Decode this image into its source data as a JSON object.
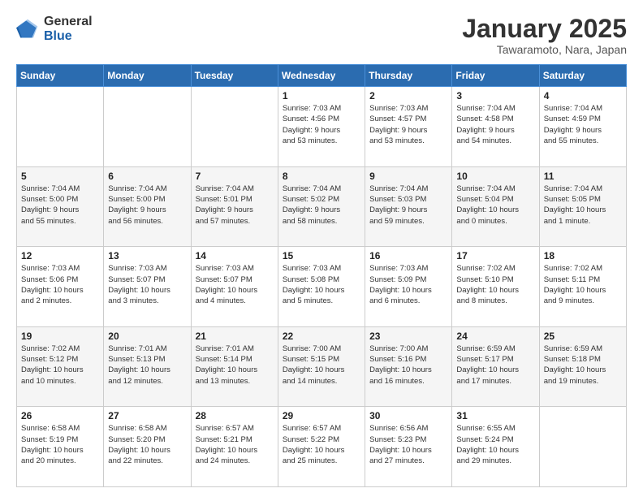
{
  "logo": {
    "general": "General",
    "blue": "Blue"
  },
  "header": {
    "title": "January 2025",
    "location": "Tawaramoto, Nara, Japan"
  },
  "weekdays": [
    "Sunday",
    "Monday",
    "Tuesday",
    "Wednesday",
    "Thursday",
    "Friday",
    "Saturday"
  ],
  "weeks": [
    [
      {
        "day": "",
        "info": ""
      },
      {
        "day": "",
        "info": ""
      },
      {
        "day": "",
        "info": ""
      },
      {
        "day": "1",
        "info": "Sunrise: 7:03 AM\nSunset: 4:56 PM\nDaylight: 9 hours\nand 53 minutes."
      },
      {
        "day": "2",
        "info": "Sunrise: 7:03 AM\nSunset: 4:57 PM\nDaylight: 9 hours\nand 53 minutes."
      },
      {
        "day": "3",
        "info": "Sunrise: 7:04 AM\nSunset: 4:58 PM\nDaylight: 9 hours\nand 54 minutes."
      },
      {
        "day": "4",
        "info": "Sunrise: 7:04 AM\nSunset: 4:59 PM\nDaylight: 9 hours\nand 55 minutes."
      }
    ],
    [
      {
        "day": "5",
        "info": "Sunrise: 7:04 AM\nSunset: 5:00 PM\nDaylight: 9 hours\nand 55 minutes."
      },
      {
        "day": "6",
        "info": "Sunrise: 7:04 AM\nSunset: 5:00 PM\nDaylight: 9 hours\nand 56 minutes."
      },
      {
        "day": "7",
        "info": "Sunrise: 7:04 AM\nSunset: 5:01 PM\nDaylight: 9 hours\nand 57 minutes."
      },
      {
        "day": "8",
        "info": "Sunrise: 7:04 AM\nSunset: 5:02 PM\nDaylight: 9 hours\nand 58 minutes."
      },
      {
        "day": "9",
        "info": "Sunrise: 7:04 AM\nSunset: 5:03 PM\nDaylight: 9 hours\nand 59 minutes."
      },
      {
        "day": "10",
        "info": "Sunrise: 7:04 AM\nSunset: 5:04 PM\nDaylight: 10 hours\nand 0 minutes."
      },
      {
        "day": "11",
        "info": "Sunrise: 7:04 AM\nSunset: 5:05 PM\nDaylight: 10 hours\nand 1 minute."
      }
    ],
    [
      {
        "day": "12",
        "info": "Sunrise: 7:03 AM\nSunset: 5:06 PM\nDaylight: 10 hours\nand 2 minutes."
      },
      {
        "day": "13",
        "info": "Sunrise: 7:03 AM\nSunset: 5:07 PM\nDaylight: 10 hours\nand 3 minutes."
      },
      {
        "day": "14",
        "info": "Sunrise: 7:03 AM\nSunset: 5:07 PM\nDaylight: 10 hours\nand 4 minutes."
      },
      {
        "day": "15",
        "info": "Sunrise: 7:03 AM\nSunset: 5:08 PM\nDaylight: 10 hours\nand 5 minutes."
      },
      {
        "day": "16",
        "info": "Sunrise: 7:03 AM\nSunset: 5:09 PM\nDaylight: 10 hours\nand 6 minutes."
      },
      {
        "day": "17",
        "info": "Sunrise: 7:02 AM\nSunset: 5:10 PM\nDaylight: 10 hours\nand 8 minutes."
      },
      {
        "day": "18",
        "info": "Sunrise: 7:02 AM\nSunset: 5:11 PM\nDaylight: 10 hours\nand 9 minutes."
      }
    ],
    [
      {
        "day": "19",
        "info": "Sunrise: 7:02 AM\nSunset: 5:12 PM\nDaylight: 10 hours\nand 10 minutes."
      },
      {
        "day": "20",
        "info": "Sunrise: 7:01 AM\nSunset: 5:13 PM\nDaylight: 10 hours\nand 12 minutes."
      },
      {
        "day": "21",
        "info": "Sunrise: 7:01 AM\nSunset: 5:14 PM\nDaylight: 10 hours\nand 13 minutes."
      },
      {
        "day": "22",
        "info": "Sunrise: 7:00 AM\nSunset: 5:15 PM\nDaylight: 10 hours\nand 14 minutes."
      },
      {
        "day": "23",
        "info": "Sunrise: 7:00 AM\nSunset: 5:16 PM\nDaylight: 10 hours\nand 16 minutes."
      },
      {
        "day": "24",
        "info": "Sunrise: 6:59 AM\nSunset: 5:17 PM\nDaylight: 10 hours\nand 17 minutes."
      },
      {
        "day": "25",
        "info": "Sunrise: 6:59 AM\nSunset: 5:18 PM\nDaylight: 10 hours\nand 19 minutes."
      }
    ],
    [
      {
        "day": "26",
        "info": "Sunrise: 6:58 AM\nSunset: 5:19 PM\nDaylight: 10 hours\nand 20 minutes."
      },
      {
        "day": "27",
        "info": "Sunrise: 6:58 AM\nSunset: 5:20 PM\nDaylight: 10 hours\nand 22 minutes."
      },
      {
        "day": "28",
        "info": "Sunrise: 6:57 AM\nSunset: 5:21 PM\nDaylight: 10 hours\nand 24 minutes."
      },
      {
        "day": "29",
        "info": "Sunrise: 6:57 AM\nSunset: 5:22 PM\nDaylight: 10 hours\nand 25 minutes."
      },
      {
        "day": "30",
        "info": "Sunrise: 6:56 AM\nSunset: 5:23 PM\nDaylight: 10 hours\nand 27 minutes."
      },
      {
        "day": "31",
        "info": "Sunrise: 6:55 AM\nSunset: 5:24 PM\nDaylight: 10 hours\nand 29 minutes."
      },
      {
        "day": "",
        "info": ""
      }
    ]
  ]
}
